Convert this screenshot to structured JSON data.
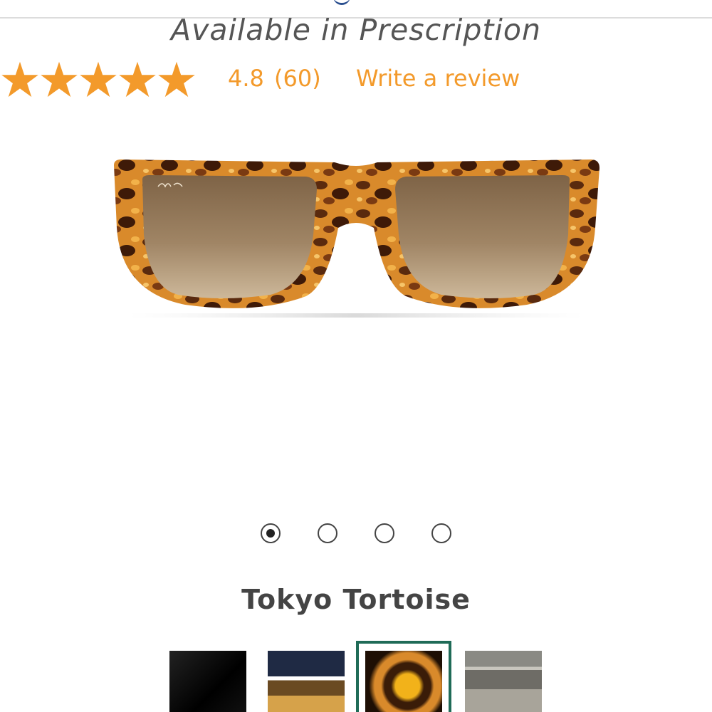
{
  "product": {
    "subtitle": "Available in Prescription",
    "color_name": "Tokyo Tortoise"
  },
  "rating": {
    "value": "4.8",
    "count": "(60)",
    "stars_filled": 5,
    "stars_total": 5,
    "write_review_label": "Write a review",
    "star_color": "#f39a2b"
  },
  "gallery": {
    "total_images": 4,
    "active_index": 0
  },
  "swatches": {
    "count": 4,
    "selected_index": 2,
    "selected_ring_color": "#1f6b57"
  },
  "colors": {
    "accent": "#f39a2b",
    "text": "#444444"
  }
}
